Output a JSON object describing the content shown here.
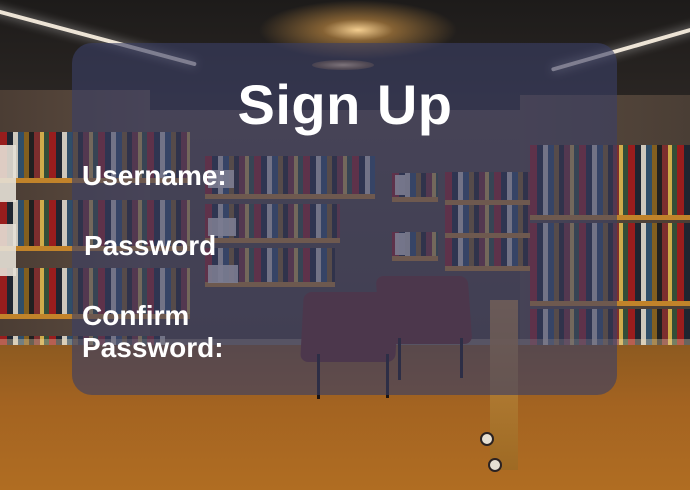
{
  "form": {
    "title": "Sign Up",
    "fields": [
      {
        "label": "Username:"
      },
      {
        "label": "Password"
      },
      {
        "label": "Confirm\nPassword:"
      }
    ]
  },
  "background": {
    "scene": "library-interior",
    "colors": {
      "overlay": "#3A3F66",
      "floor": "#A36321",
      "shelf_accent": "#C8872A",
      "text": "#FFFFFF"
    }
  }
}
